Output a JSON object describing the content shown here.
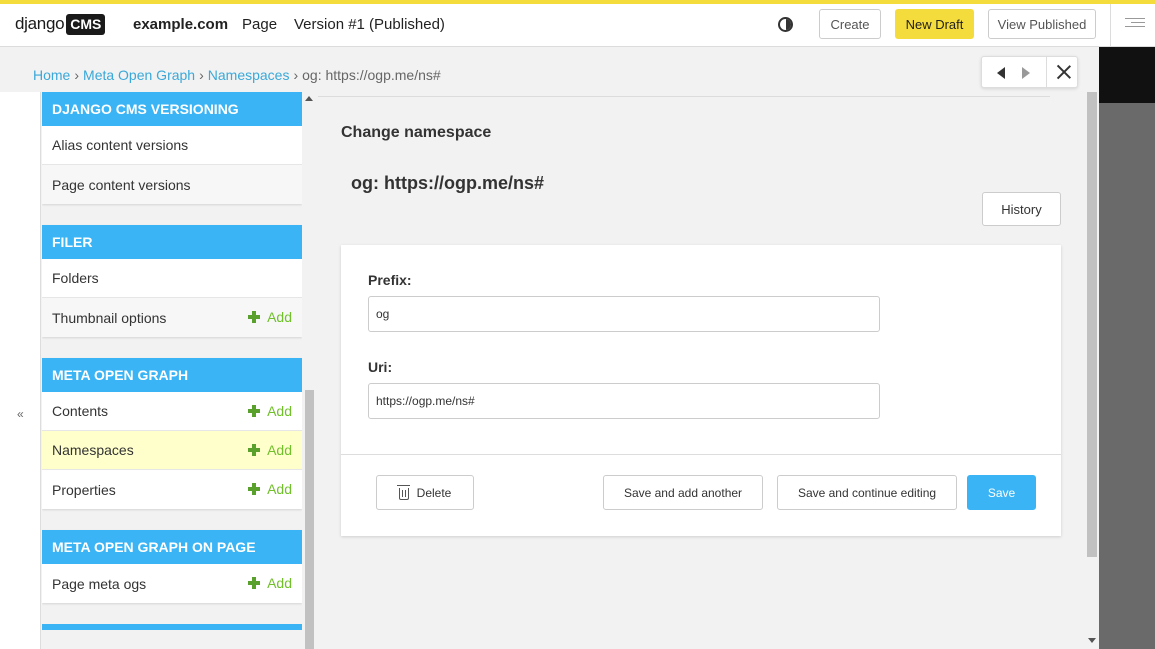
{
  "toolbar": {
    "logo_django": "django",
    "logo_cms": "CMS",
    "site": "example.com",
    "page": "Page",
    "version": "Version #1 (Published)",
    "contrast_icon": "half-circle-contrast",
    "create": "Create",
    "new_draft": "New Draft",
    "view_published": "View Published",
    "accent_color": "#f5dc3d"
  },
  "breadcrumb": {
    "home": "Home",
    "app": "Meta Open Graph",
    "model": "Namespaces",
    "current": "og: https://ogp.me/ns#",
    "separator": "›"
  },
  "sidebar": {
    "collapse": "«",
    "modules": [
      {
        "title": "DJANGO CMS VERSIONING",
        "rows": [
          {
            "label": "Alias content versions",
            "add": ""
          },
          {
            "label": "Page content versions",
            "add": ""
          }
        ]
      },
      {
        "title": "FILER",
        "rows": [
          {
            "label": "Folders",
            "add": ""
          },
          {
            "label": "Thumbnail options",
            "add": "Add"
          }
        ]
      },
      {
        "title": "META OPEN GRAPH",
        "rows": [
          {
            "label": "Contents",
            "add": "Add"
          },
          {
            "label": "Namespaces",
            "add": "Add"
          },
          {
            "label": "Properties",
            "add": "Add"
          }
        ]
      },
      {
        "title": "META OPEN GRAPH ON PAGE",
        "rows": [
          {
            "label": "Page meta ogs",
            "add": "Add"
          }
        ]
      }
    ],
    "header_color": "#3ab4f5",
    "active_row_color": "#ffffcc"
  },
  "main": {
    "heading": "Change namespace",
    "object_title": "og: https://ogp.me/ns#",
    "history": "History",
    "form": {
      "prefix_label": "Prefix:",
      "prefix_value": "og",
      "uri_label": "Uri:",
      "uri_value": "https://ogp.me/ns#"
    },
    "actions": {
      "delete": "Delete",
      "save_add_another": "Save and add another",
      "save_continue": "Save and continue editing",
      "save": "Save"
    }
  }
}
